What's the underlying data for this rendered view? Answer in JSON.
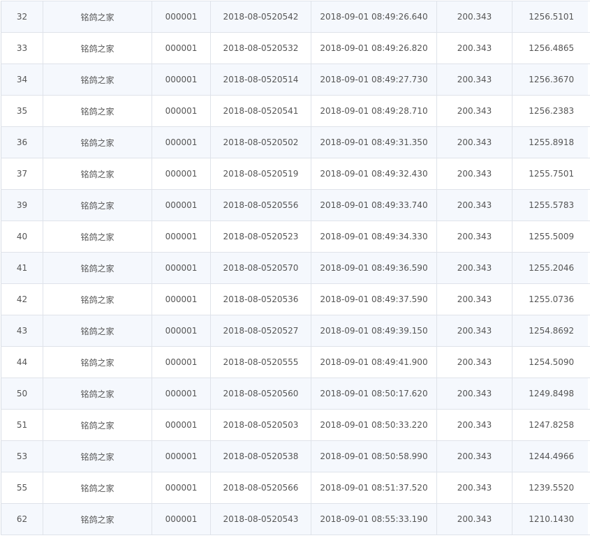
{
  "table": {
    "rows": [
      {
        "rank": "32",
        "loft": "铭鸽之家",
        "owner_no": "000001",
        "ring": "2018-08-0520542",
        "arrival": "2018-09-01 08:49:26.640",
        "distance": "200.343",
        "speed": "1256.5101"
      },
      {
        "rank": "33",
        "loft": "铭鸽之家",
        "owner_no": "000001",
        "ring": "2018-08-0520532",
        "arrival": "2018-09-01 08:49:26.820",
        "distance": "200.343",
        "speed": "1256.4865"
      },
      {
        "rank": "34",
        "loft": "铭鸽之家",
        "owner_no": "000001",
        "ring": "2018-08-0520514",
        "arrival": "2018-09-01 08:49:27.730",
        "distance": "200.343",
        "speed": "1256.3670"
      },
      {
        "rank": "35",
        "loft": "铭鸽之家",
        "owner_no": "000001",
        "ring": "2018-08-0520541",
        "arrival": "2018-09-01 08:49:28.710",
        "distance": "200.343",
        "speed": "1256.2383"
      },
      {
        "rank": "36",
        "loft": "铭鸽之家",
        "owner_no": "000001",
        "ring": "2018-08-0520502",
        "arrival": "2018-09-01 08:49:31.350",
        "distance": "200.343",
        "speed": "1255.8918"
      },
      {
        "rank": "37",
        "loft": "铭鸽之家",
        "owner_no": "000001",
        "ring": "2018-08-0520519",
        "arrival": "2018-09-01 08:49:32.430",
        "distance": "200.343",
        "speed": "1255.7501"
      },
      {
        "rank": "39",
        "loft": "铭鸽之家",
        "owner_no": "000001",
        "ring": "2018-08-0520556",
        "arrival": "2018-09-01 08:49:33.740",
        "distance": "200.343",
        "speed": "1255.5783"
      },
      {
        "rank": "40",
        "loft": "铭鸽之家",
        "owner_no": "000001",
        "ring": "2018-08-0520523",
        "arrival": "2018-09-01 08:49:34.330",
        "distance": "200.343",
        "speed": "1255.5009"
      },
      {
        "rank": "41",
        "loft": "铭鸽之家",
        "owner_no": "000001",
        "ring": "2018-08-0520570",
        "arrival": "2018-09-01 08:49:36.590",
        "distance": "200.343",
        "speed": "1255.2046"
      },
      {
        "rank": "42",
        "loft": "铭鸽之家",
        "owner_no": "000001",
        "ring": "2018-08-0520536",
        "arrival": "2018-09-01 08:49:37.590",
        "distance": "200.343",
        "speed": "1255.0736"
      },
      {
        "rank": "43",
        "loft": "铭鸽之家",
        "owner_no": "000001",
        "ring": "2018-08-0520527",
        "arrival": "2018-09-01 08:49:39.150",
        "distance": "200.343",
        "speed": "1254.8692"
      },
      {
        "rank": "44",
        "loft": "铭鸽之家",
        "owner_no": "000001",
        "ring": "2018-08-0520555",
        "arrival": "2018-09-01 08:49:41.900",
        "distance": "200.343",
        "speed": "1254.5090"
      },
      {
        "rank": "50",
        "loft": "铭鸽之家",
        "owner_no": "000001",
        "ring": "2018-08-0520560",
        "arrival": "2018-09-01 08:50:17.620",
        "distance": "200.343",
        "speed": "1249.8498"
      },
      {
        "rank": "51",
        "loft": "铭鸽之家",
        "owner_no": "000001",
        "ring": "2018-08-0520503",
        "arrival": "2018-09-01 08:50:33.220",
        "distance": "200.343",
        "speed": "1247.8258"
      },
      {
        "rank": "53",
        "loft": "铭鸽之家",
        "owner_no": "000001",
        "ring": "2018-08-0520538",
        "arrival": "2018-09-01 08:50:58.990",
        "distance": "200.343",
        "speed": "1244.4966"
      },
      {
        "rank": "55",
        "loft": "铭鸽之家",
        "owner_no": "000001",
        "ring": "2018-08-0520566",
        "arrival": "2018-09-01 08:51:37.520",
        "distance": "200.343",
        "speed": "1239.5520"
      },
      {
        "rank": "62",
        "loft": "铭鸽之家",
        "owner_no": "000001",
        "ring": "2018-08-0520543",
        "arrival": "2018-09-01 08:55:33.190",
        "distance": "200.343",
        "speed": "1210.1430"
      }
    ]
  },
  "colors": {
    "row_alt_bg": "#f5f8fd",
    "row_bg": "#ffffff",
    "border": "#dfe3ea",
    "text": "#555555"
  }
}
